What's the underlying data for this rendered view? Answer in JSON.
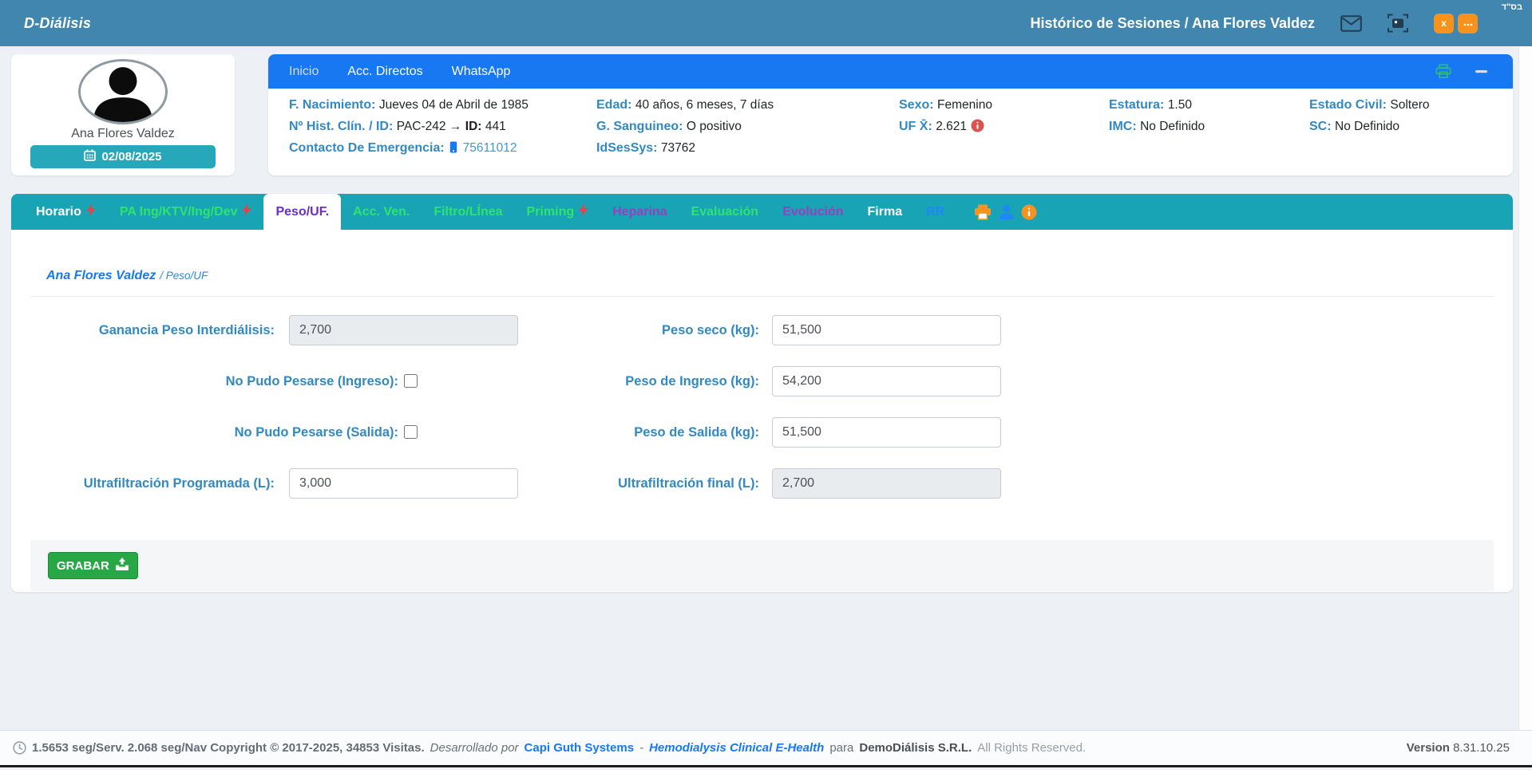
{
  "header": {
    "app_title": "D-Diálisis",
    "page_title": "Histórico de Sesiones / Ana Flores Valdez",
    "corner_text": "בס\"ד",
    "close_label": "x"
  },
  "patient": {
    "name": "Ana Flores Valdez",
    "session_date": "02/08/2025"
  },
  "nav": {
    "items": [
      {
        "label": "Inicio"
      },
      {
        "label": "Acc. Directos"
      },
      {
        "label": "WhatsApp"
      }
    ]
  },
  "info": {
    "col1": [
      {
        "label": "F. Nacimiento:",
        "value": "Jueves 04 de Abril de 1985"
      },
      {
        "label": "Nº Hist. Clín. / ID:",
        "value": "PAC-242 →",
        "bold_label": "ID:",
        "bold_value": "441"
      },
      {
        "label": "Contacto De Emergencia:",
        "phone": "75611012"
      }
    ],
    "col2": [
      {
        "label": "Edad:",
        "value": "40 años, 6 meses, 7 días"
      },
      {
        "label": "G. Sanguineo:",
        "value": "O positivo"
      },
      {
        "label": "IdSesSys:",
        "value": "73762"
      }
    ],
    "col3": [
      {
        "label": "Sexo:",
        "value": "Femenino"
      },
      {
        "label": "UF X̄:",
        "value": "2.621"
      }
    ],
    "col4": [
      {
        "label": "Estatura:",
        "value": "1.50"
      },
      {
        "label": "IMC:",
        "value": "No Definido"
      }
    ],
    "col5": [
      {
        "label": "Estado Civil:",
        "value": "Soltero"
      },
      {
        "label": "SC:",
        "value": "No Definido"
      }
    ]
  },
  "tabs": [
    {
      "label": "Horario"
    },
    {
      "label": "PA Ing/KTV/Ing/Dev"
    },
    {
      "label": "Peso/UF."
    },
    {
      "label": "Acc. Ven."
    },
    {
      "label": "Filtro/LÍnea"
    },
    {
      "label": "Priming"
    },
    {
      "label": "Heparina"
    },
    {
      "label": "Evaluación"
    },
    {
      "label": "Evolución"
    },
    {
      "label": "Firma"
    },
    {
      "label": "RR"
    }
  ],
  "breadcrumb": {
    "name": "Ana Flores Valdez",
    "path": "/ Peso/UF"
  },
  "form": {
    "left": [
      {
        "label": "Ganancia Peso Interdiálisis:",
        "value": "2,700"
      },
      {
        "label": "No Pudo Pesarse (Ingreso):"
      },
      {
        "label": "No Pudo Pesarse (Salida):"
      },
      {
        "label": "Ultrafiltración Programada (L):",
        "value": "3,000"
      }
    ],
    "right": [
      {
        "label": "Peso seco (kg):",
        "value": "51,500"
      },
      {
        "label": "Peso de Ingreso (kg):",
        "value": "54,200"
      },
      {
        "label": "Peso de Salida (kg):",
        "value": "51,500"
      },
      {
        "label": "Ultrafiltración final (L):",
        "value": "2,700"
      }
    ],
    "save_label": "GRABAR"
  },
  "footer": {
    "stats": "1.5653 seg/Serv. 2.068 seg/Nav Copyright © 2017-2025, 34853 Visitas.",
    "developed_by": "Desarrollado por",
    "company": "Capi Guth Systems",
    "separator": "-",
    "product": "Hemodialysis Clinical E-Health",
    "para": "para",
    "client": "DemoDiálisis S.R.L.",
    "rights": "All Rights Reserved.",
    "version_label": "Version",
    "version_value": "8.31.10.25"
  },
  "colors": {
    "header": "#4086ae",
    "nav_blue": "#1778f2",
    "tab_teal": "#19a4b5",
    "accent_green": "#2ee36e",
    "accent_purple": "#9a3ec0",
    "active_tab_purple": "#6a2fc2",
    "label_blue": "#3289c2",
    "orange": "#f6921e",
    "save_green": "#28a745",
    "danger_red": "#d9534f"
  }
}
